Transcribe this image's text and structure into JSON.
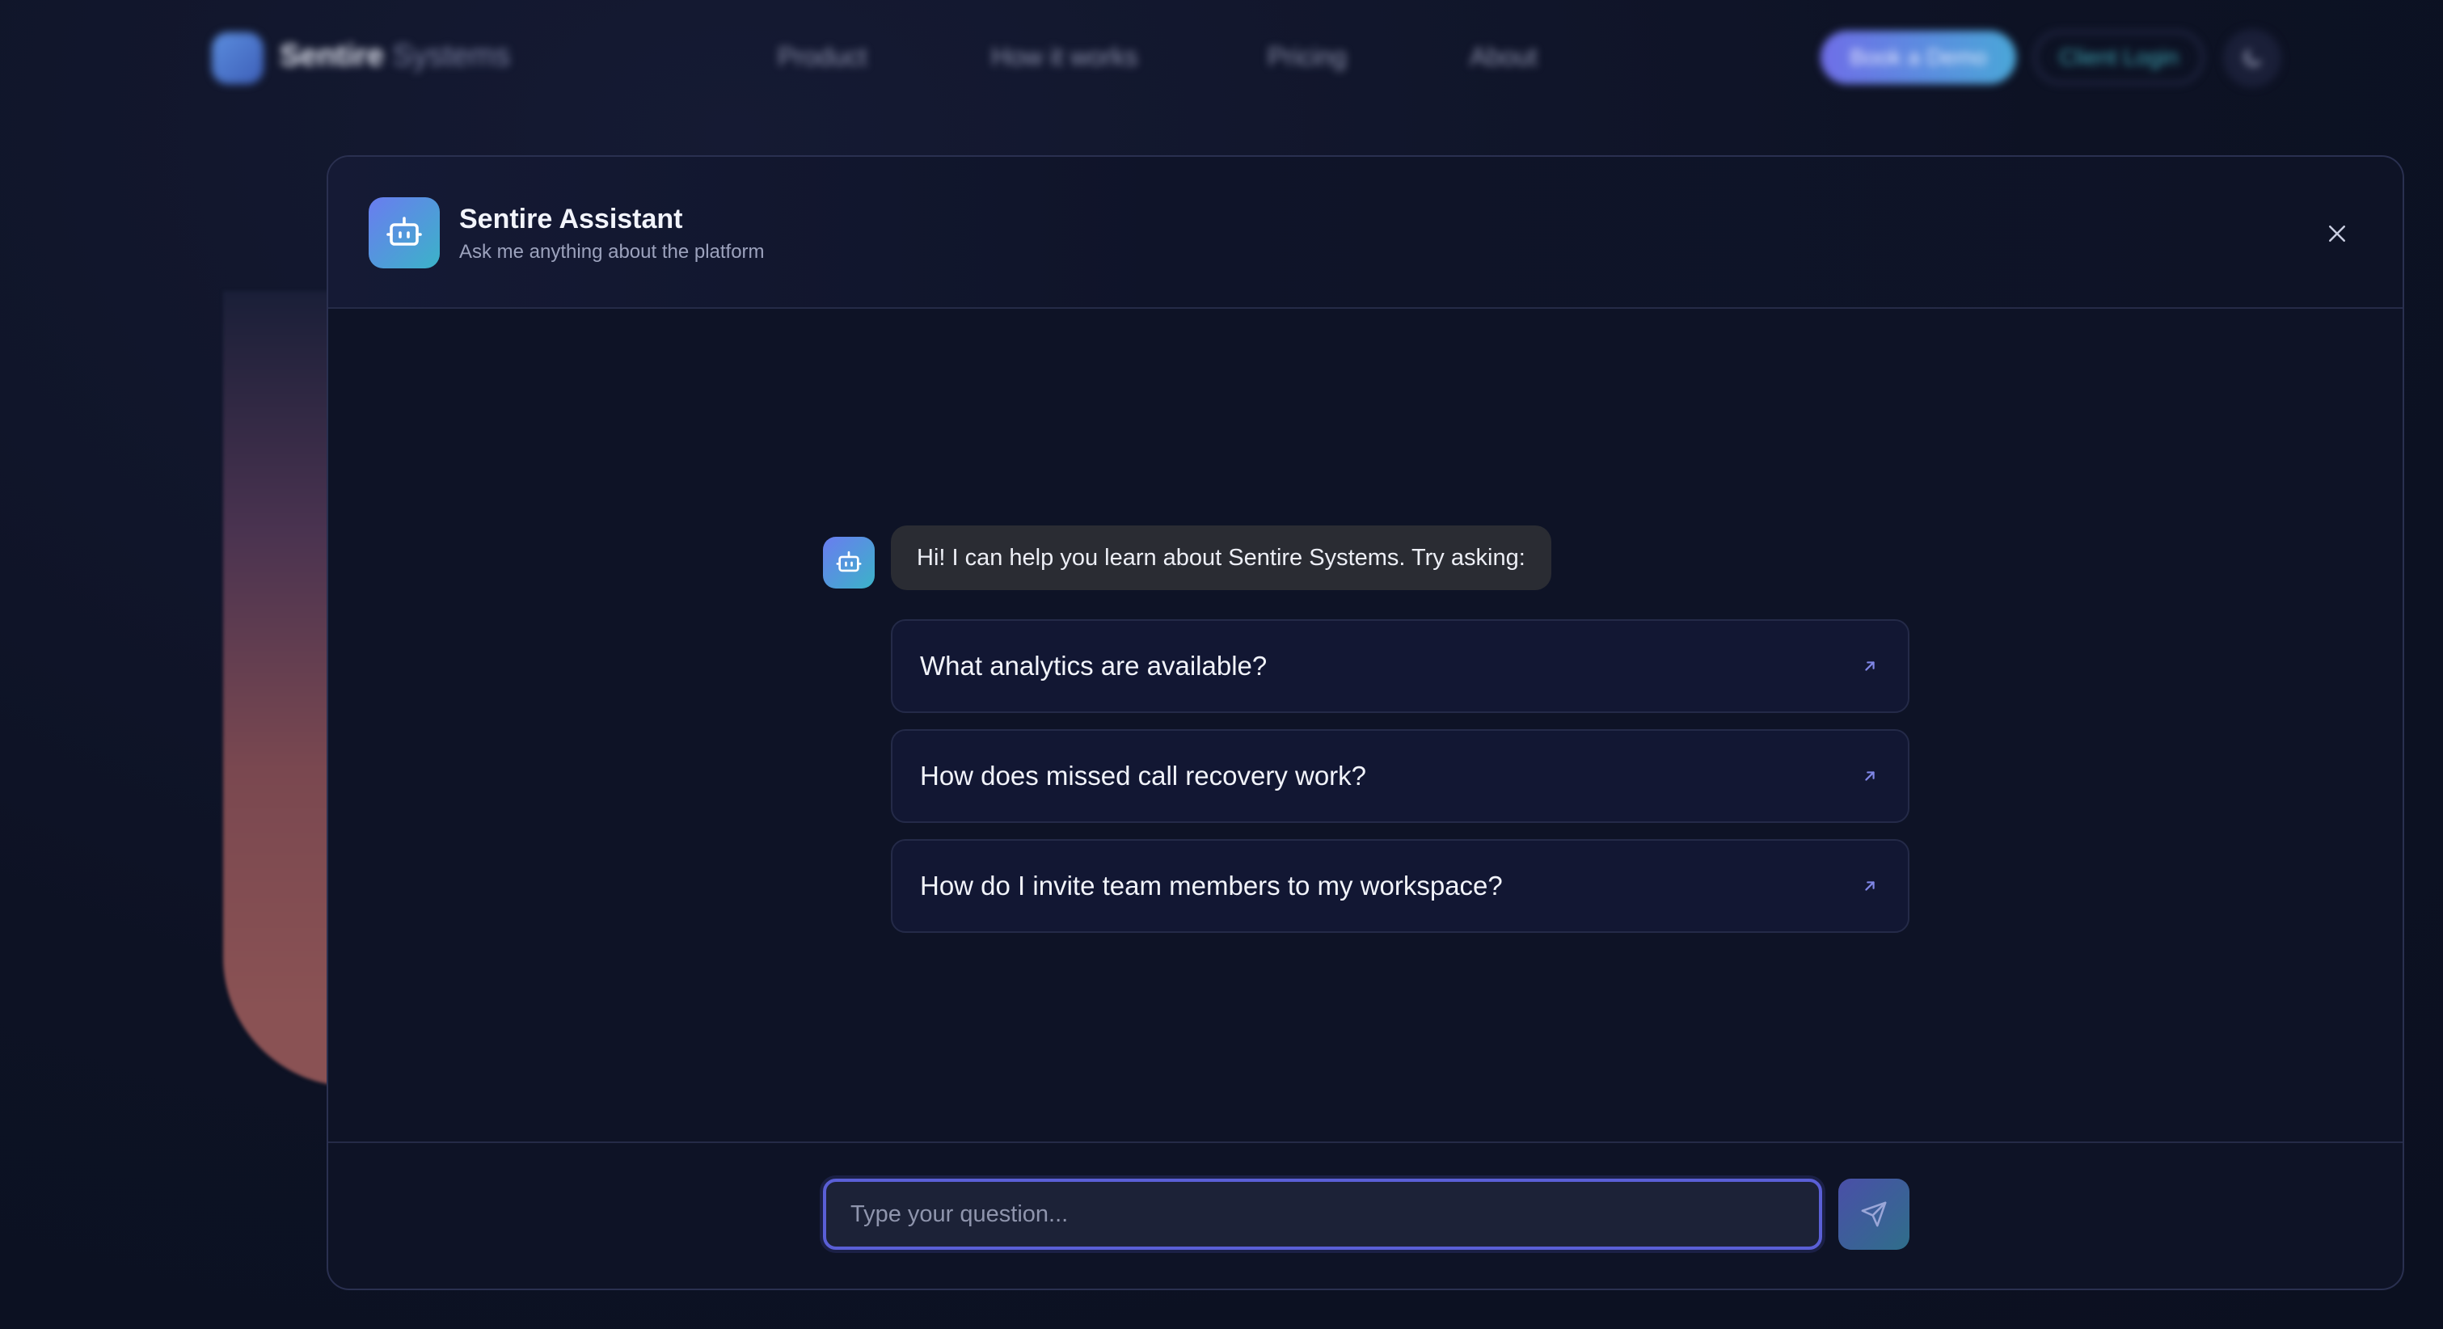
{
  "background": {
    "logo": {
      "brand_strong": "Sentire",
      "brand_light": "Systems"
    },
    "nav": {
      "links": [
        "Product",
        "How it works",
        "Pricing",
        "About"
      ],
      "book_demo_label": "Book a Demo",
      "client_login_label": "Client Login"
    }
  },
  "assistant": {
    "title": "Sentire Assistant",
    "subtitle": "Ask me anything about the platform",
    "greeting": "Hi! I can help you learn about Sentire Systems. Try asking:",
    "suggestions": [
      "What analytics are available?",
      "How does missed call recovery work?",
      "How do I invite team members to my workspace?"
    ],
    "input": {
      "placeholder": "Type your question...",
      "value": ""
    }
  },
  "colors": {
    "accent": "#5a5fd6",
    "avatar_gradient_start": "#6a7cf0",
    "avatar_gradient_end": "#3bb3c8",
    "background": "#0d1224"
  },
  "icons": {
    "assistant_avatar": "robot-icon",
    "close": "close-icon",
    "suggestion_arrow": "arrow-up-right-icon",
    "send": "send-icon",
    "theme_toggle": "moon-icon",
    "logo": "waveform-icon"
  }
}
